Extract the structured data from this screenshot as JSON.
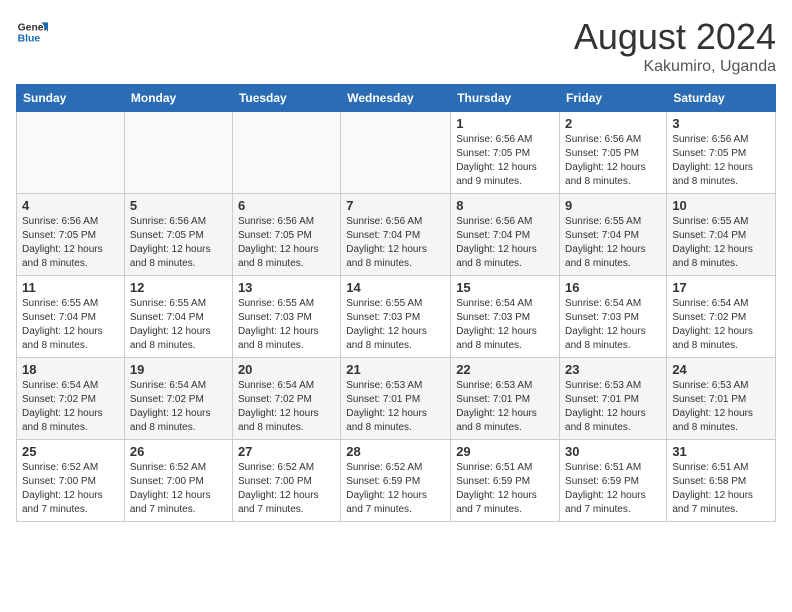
{
  "header": {
    "logo_line1": "General",
    "logo_line2": "Blue",
    "title": "August 2024",
    "subtitle": "Kakumiro, Uganda"
  },
  "days_of_week": [
    "Sunday",
    "Monday",
    "Tuesday",
    "Wednesday",
    "Thursday",
    "Friday",
    "Saturday"
  ],
  "weeks": [
    [
      {
        "day": "",
        "info": ""
      },
      {
        "day": "",
        "info": ""
      },
      {
        "day": "",
        "info": ""
      },
      {
        "day": "",
        "info": ""
      },
      {
        "day": "1",
        "info": "Sunrise: 6:56 AM\nSunset: 7:05 PM\nDaylight: 12 hours\nand 9 minutes."
      },
      {
        "day": "2",
        "info": "Sunrise: 6:56 AM\nSunset: 7:05 PM\nDaylight: 12 hours\nand 8 minutes."
      },
      {
        "day": "3",
        "info": "Sunrise: 6:56 AM\nSunset: 7:05 PM\nDaylight: 12 hours\nand 8 minutes."
      }
    ],
    [
      {
        "day": "4",
        "info": "Sunrise: 6:56 AM\nSunset: 7:05 PM\nDaylight: 12 hours\nand 8 minutes."
      },
      {
        "day": "5",
        "info": "Sunrise: 6:56 AM\nSunset: 7:05 PM\nDaylight: 12 hours\nand 8 minutes."
      },
      {
        "day": "6",
        "info": "Sunrise: 6:56 AM\nSunset: 7:05 PM\nDaylight: 12 hours\nand 8 minutes."
      },
      {
        "day": "7",
        "info": "Sunrise: 6:56 AM\nSunset: 7:04 PM\nDaylight: 12 hours\nand 8 minutes."
      },
      {
        "day": "8",
        "info": "Sunrise: 6:56 AM\nSunset: 7:04 PM\nDaylight: 12 hours\nand 8 minutes."
      },
      {
        "day": "9",
        "info": "Sunrise: 6:55 AM\nSunset: 7:04 PM\nDaylight: 12 hours\nand 8 minutes."
      },
      {
        "day": "10",
        "info": "Sunrise: 6:55 AM\nSunset: 7:04 PM\nDaylight: 12 hours\nand 8 minutes."
      }
    ],
    [
      {
        "day": "11",
        "info": "Sunrise: 6:55 AM\nSunset: 7:04 PM\nDaylight: 12 hours\nand 8 minutes."
      },
      {
        "day": "12",
        "info": "Sunrise: 6:55 AM\nSunset: 7:04 PM\nDaylight: 12 hours\nand 8 minutes."
      },
      {
        "day": "13",
        "info": "Sunrise: 6:55 AM\nSunset: 7:03 PM\nDaylight: 12 hours\nand 8 minutes."
      },
      {
        "day": "14",
        "info": "Sunrise: 6:55 AM\nSunset: 7:03 PM\nDaylight: 12 hours\nand 8 minutes."
      },
      {
        "day": "15",
        "info": "Sunrise: 6:54 AM\nSunset: 7:03 PM\nDaylight: 12 hours\nand 8 minutes."
      },
      {
        "day": "16",
        "info": "Sunrise: 6:54 AM\nSunset: 7:03 PM\nDaylight: 12 hours\nand 8 minutes."
      },
      {
        "day": "17",
        "info": "Sunrise: 6:54 AM\nSunset: 7:02 PM\nDaylight: 12 hours\nand 8 minutes."
      }
    ],
    [
      {
        "day": "18",
        "info": "Sunrise: 6:54 AM\nSunset: 7:02 PM\nDaylight: 12 hours\nand 8 minutes."
      },
      {
        "day": "19",
        "info": "Sunrise: 6:54 AM\nSunset: 7:02 PM\nDaylight: 12 hours\nand 8 minutes."
      },
      {
        "day": "20",
        "info": "Sunrise: 6:54 AM\nSunset: 7:02 PM\nDaylight: 12 hours\nand 8 minutes."
      },
      {
        "day": "21",
        "info": "Sunrise: 6:53 AM\nSunset: 7:01 PM\nDaylight: 12 hours\nand 8 minutes."
      },
      {
        "day": "22",
        "info": "Sunrise: 6:53 AM\nSunset: 7:01 PM\nDaylight: 12 hours\nand 8 minutes."
      },
      {
        "day": "23",
        "info": "Sunrise: 6:53 AM\nSunset: 7:01 PM\nDaylight: 12 hours\nand 8 minutes."
      },
      {
        "day": "24",
        "info": "Sunrise: 6:53 AM\nSunset: 7:01 PM\nDaylight: 12 hours\nand 8 minutes."
      }
    ],
    [
      {
        "day": "25",
        "info": "Sunrise: 6:52 AM\nSunset: 7:00 PM\nDaylight: 12 hours\nand 7 minutes."
      },
      {
        "day": "26",
        "info": "Sunrise: 6:52 AM\nSunset: 7:00 PM\nDaylight: 12 hours\nand 7 minutes."
      },
      {
        "day": "27",
        "info": "Sunrise: 6:52 AM\nSunset: 7:00 PM\nDaylight: 12 hours\nand 7 minutes."
      },
      {
        "day": "28",
        "info": "Sunrise: 6:52 AM\nSunset: 6:59 PM\nDaylight: 12 hours\nand 7 minutes."
      },
      {
        "day": "29",
        "info": "Sunrise: 6:51 AM\nSunset: 6:59 PM\nDaylight: 12 hours\nand 7 minutes."
      },
      {
        "day": "30",
        "info": "Sunrise: 6:51 AM\nSunset: 6:59 PM\nDaylight: 12 hours\nand 7 minutes."
      },
      {
        "day": "31",
        "info": "Sunrise: 6:51 AM\nSunset: 6:58 PM\nDaylight: 12 hours\nand 7 minutes."
      }
    ]
  ]
}
